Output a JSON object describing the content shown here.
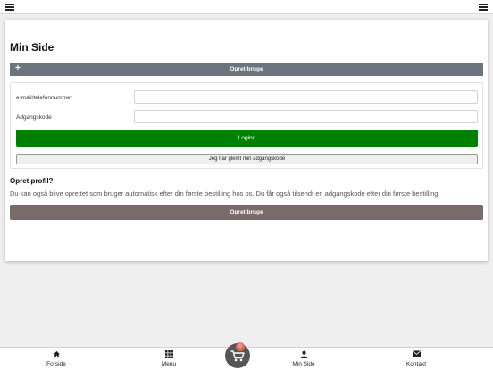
{
  "page": {
    "title": "Min Side"
  },
  "create_user_bar": {
    "label": "Opret bruge",
    "icon": "plus-icon"
  },
  "login": {
    "email_label": "e-mail/telefonnummer",
    "email_value": "",
    "password_label": "Adgangskode",
    "password_value": "",
    "login_button": "Logind",
    "forgot_button": "Jeg har glemt min adgangskode"
  },
  "profile": {
    "title": "Opret profil?",
    "text": "Du kan også blive oprettet som bruger automatisk efter din første bestilling hos os. Du får også tilsendt en adgangskode efter din første bestilling.",
    "button": "Opret bruge"
  },
  "bottom_nav": {
    "items": [
      {
        "label": "Forside",
        "icon": "home-icon"
      },
      {
        "label": "Menu",
        "icon": "grid-icon"
      },
      {
        "label": "Min Side",
        "icon": "user-icon"
      },
      {
        "label": "Kontakt",
        "icon": "envelope-icon"
      }
    ]
  },
  "cart": {
    "count": "0",
    "icon": "cart-icon"
  },
  "colors": {
    "login_green": "#008000",
    "bar_gray": "#6c757d",
    "create_brown": "#7a6a6a",
    "badge": "#e06a5a"
  }
}
